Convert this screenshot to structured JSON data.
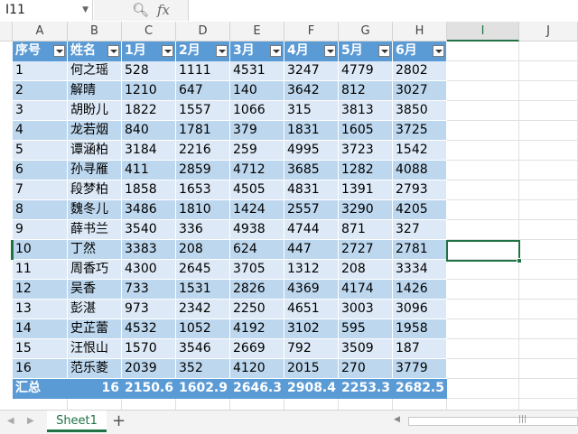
{
  "formula_bar": {
    "name_box": "I11",
    "formula": ""
  },
  "columns": [
    "A",
    "B",
    "C",
    "D",
    "E",
    "F",
    "G",
    "H",
    "I",
    "J"
  ],
  "table": {
    "headers": [
      "序号",
      "姓名",
      "1月",
      "2月",
      "3月",
      "4月",
      "5月",
      "6月"
    ],
    "rows": [
      [
        "1",
        "何之瑶",
        "528",
        "1111",
        "4531",
        "3247",
        "4779",
        "2802"
      ],
      [
        "2",
        "解晴",
        "1210",
        "647",
        "140",
        "3642",
        "812",
        "3027"
      ],
      [
        "3",
        "胡盼儿",
        "1822",
        "1557",
        "1066",
        "315",
        "3813",
        "3850"
      ],
      [
        "4",
        "龙若烟",
        "840",
        "1781",
        "379",
        "1831",
        "1605",
        "3725"
      ],
      [
        "5",
        "谭涵柏",
        "3184",
        "2216",
        "259",
        "4995",
        "3723",
        "1542"
      ],
      [
        "6",
        "孙寻雁",
        "411",
        "2859",
        "4712",
        "3685",
        "1282",
        "4088"
      ],
      [
        "7",
        "段梦柏",
        "1858",
        "1653",
        "4505",
        "4831",
        "1391",
        "2793"
      ],
      [
        "8",
        "魏冬儿",
        "3486",
        "1810",
        "1424",
        "2557",
        "3290",
        "4205"
      ],
      [
        "9",
        "薛书兰",
        "3540",
        "336",
        "4938",
        "4744",
        "871",
        "327"
      ],
      [
        "10",
        "丁然",
        "3383",
        "208",
        "624",
        "447",
        "2727",
        "2781"
      ],
      [
        "11",
        "周香巧",
        "4300",
        "2645",
        "3705",
        "1312",
        "208",
        "3334"
      ],
      [
        "12",
        "吴香",
        "733",
        "1531",
        "2826",
        "4369",
        "4174",
        "1426"
      ],
      [
        "13",
        "彭湛",
        "973",
        "2342",
        "2250",
        "4651",
        "3003",
        "3096"
      ],
      [
        "14",
        "史芷蕾",
        "4532",
        "1052",
        "4192",
        "3102",
        "595",
        "1958"
      ],
      [
        "15",
        "汪恨山",
        "1570",
        "3546",
        "2669",
        "792",
        "3509",
        "187"
      ],
      [
        "16",
        "范乐菱",
        "2039",
        "352",
        "4120",
        "2015",
        "270",
        "3779"
      ]
    ],
    "total_row": [
      "汇总",
      "16",
      "2150.6",
      "1602.9",
      "2646.3",
      "2908.4",
      "2253.3",
      "2682.5"
    ]
  },
  "sheet_tabs": [
    "Sheet1"
  ],
  "icons": {
    "search": "magnifier-icon",
    "function": "fx-icon"
  },
  "colors": {
    "accent": "#217346",
    "header": "#5b9bd5",
    "band_light": "#dde9f6",
    "band_dark": "#bdd7ee"
  }
}
